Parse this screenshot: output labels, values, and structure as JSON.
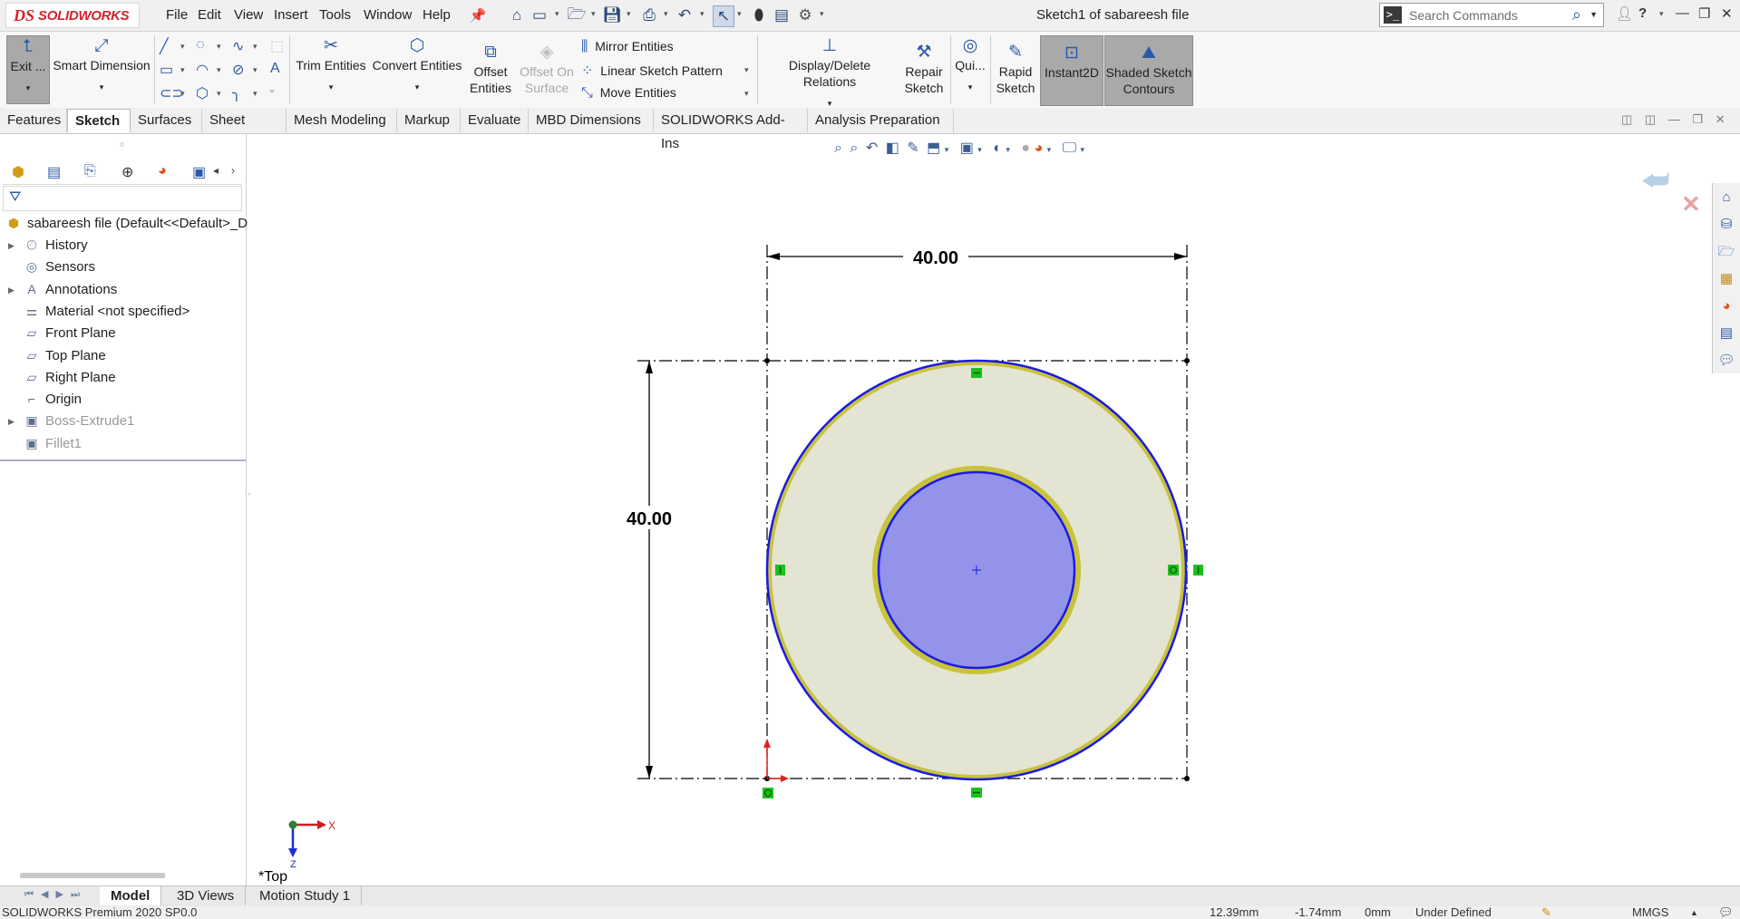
{
  "app": {
    "logo_mark": "DS",
    "logo_brand": "SOLIDWORKS",
    "document_title": "Sketch1 of sabareesh file"
  },
  "menu": [
    "File",
    "Edit",
    "View",
    "Insert",
    "Tools",
    "Window",
    "Help"
  ],
  "search": {
    "placeholder": "Search Commands",
    "prompt_glyph": ">_"
  },
  "command_manager": {
    "exit_sketch": "Exit ...",
    "smart_dimension": "Smart Dimension",
    "trim_entities": "Trim Entities",
    "convert_entities": "Convert Entities",
    "offset_entities_1": "Offset",
    "offset_entities_2": "Entities",
    "offset_on_surface_1": "Offset On",
    "offset_on_surface_2": "Surface",
    "mirror_entities": "Mirror Entities",
    "linear_sketch_pattern": "Linear Sketch Pattern",
    "move_entities": "Move Entities",
    "display_delete_relations": "Display/Delete Relations",
    "repair_sketch_1": "Repair",
    "repair_sketch_2": "Sketch",
    "quick_snaps": "Qui...",
    "rapid_sketch_1": "Rapid",
    "rapid_sketch_2": "Sketch",
    "instant2d": "Instant2D",
    "shaded_sketch_1": "Shaded Sketch",
    "shaded_sketch_2": "Contours"
  },
  "tabs": [
    "Features",
    "Sketch",
    "Surfaces",
    "Sheet Metal",
    "Mesh Modeling",
    "Markup",
    "Evaluate",
    "MBD Dimensions",
    "SOLIDWORKS Add-Ins",
    "Analysis Preparation"
  ],
  "active_tab": "Sketch",
  "feature_tree": {
    "root": "sabareesh file  (Default<<Default>_D",
    "items": [
      {
        "label": "History",
        "expandable": true,
        "grey": false
      },
      {
        "label": "Sensors",
        "expandable": false,
        "grey": false
      },
      {
        "label": "Annotations",
        "expandable": true,
        "grey": false
      },
      {
        "label": "Material <not specified>",
        "expandable": false,
        "grey": false
      },
      {
        "label": "Front Plane",
        "expandable": false,
        "grey": false
      },
      {
        "label": "Top Plane",
        "expandable": false,
        "grey": false
      },
      {
        "label": "Right Plane",
        "expandable": false,
        "grey": false
      },
      {
        "label": "Origin",
        "expandable": false,
        "grey": false
      },
      {
        "label": "Boss-Extrude1",
        "expandable": true,
        "grey": true
      },
      {
        "label": "Fillet1",
        "expandable": false,
        "grey": true
      }
    ]
  },
  "viewport": {
    "dimension_horizontal": "40.00",
    "dimension_vertical": "40.00",
    "view_label": "*Top",
    "triad_x": "X",
    "triad_z": "Z",
    "colors": {
      "ring_fill": "#e4e4d2",
      "hole_fill": "#9393e9",
      "sketch_line": "#1a1ae6",
      "highlight": "#c8c23c",
      "relation": "#19c219",
      "dimension": "#000000"
    }
  },
  "bottom_tabs": [
    "Model",
    "3D Views",
    "Motion Study 1"
  ],
  "active_bottom_tab": "Model",
  "status": {
    "product": "SOLIDWORKS Premium 2020 SP0.0",
    "x": "12.39mm",
    "y": "-1.74mm",
    "z": "0mm",
    "state": "Under Defined",
    "units": "MMGS"
  }
}
